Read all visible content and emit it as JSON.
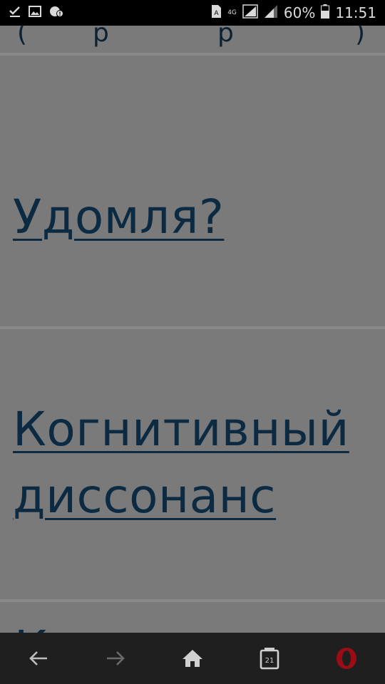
{
  "status_bar": {
    "network": "4G",
    "battery": "60%",
    "time": "11:51"
  },
  "articles": [
    {
      "title": "Удомля?"
    },
    {
      "title": "Когнитивный диссонанс"
    }
  ],
  "bottom_nav": {
    "tabs_count": "21"
  },
  "colors": {
    "link": "#0c2b42",
    "background": "#7a7a7a",
    "opera_red": "#9c0c16"
  }
}
